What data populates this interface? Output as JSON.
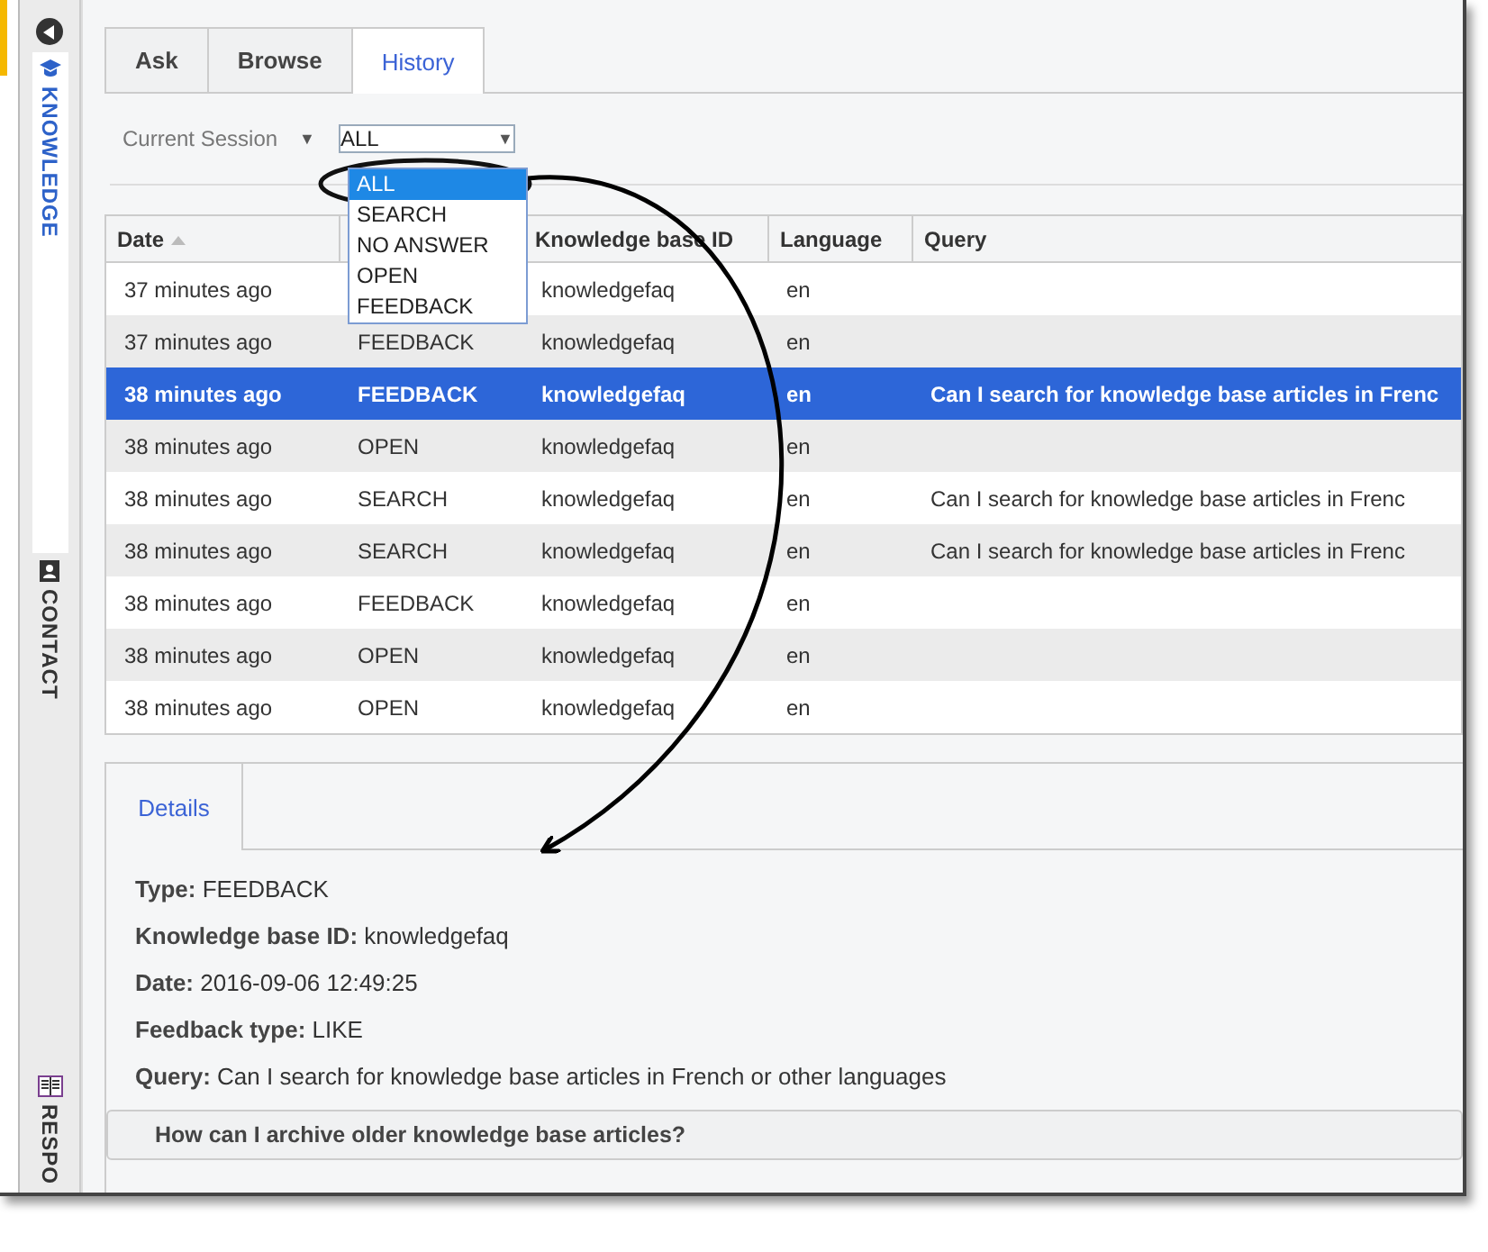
{
  "sidebar": {
    "items": [
      {
        "kind": "knowledge",
        "label": "KNOWLEDGE",
        "selected": true
      },
      {
        "kind": "contact",
        "label": "CONTACT",
        "selected": false
      },
      {
        "kind": "responses",
        "label": "RESPO",
        "selected": false
      }
    ]
  },
  "tabs": [
    {
      "label": "Ask",
      "selected": false
    },
    {
      "label": "Browse",
      "selected": false
    },
    {
      "label": "History",
      "selected": true
    }
  ],
  "filter": {
    "session": "Current Session",
    "session_caret": "▼",
    "value": "ALL",
    "caret": "▼",
    "expanded": true,
    "options": [
      {
        "label": "ALL",
        "selected": true
      },
      {
        "label": "SEARCH",
        "selected": false
      },
      {
        "label": "NO ANSWER",
        "selected": false
      },
      {
        "label": "OPEN",
        "selected": false
      },
      {
        "label": "FEEDBACK",
        "selected": false
      }
    ]
  },
  "table": {
    "columns": [
      "Date",
      "Knowledge base ID",
      "Language",
      "Query"
    ],
    "rows": [
      {
        "date": "37 minutes ago",
        "kb": "knowledgefaq",
        "language": "en",
        "selected": false
      },
      {
        "date": "37 minutes ago",
        "type": "FEEDBACK",
        "kb": "knowledgefaq",
        "language": "en",
        "selected": false
      },
      {
        "date": "38 minutes ago",
        "type": "FEEDBACK",
        "kb": "knowledgefaq",
        "language": "en",
        "query": "Can I search for knowledge base articles in Frenc",
        "selected": true
      },
      {
        "date": "38 minutes ago",
        "type": "OPEN",
        "kb": "knowledgefaq",
        "language": "en",
        "selected": false
      },
      {
        "date": "38 minutes ago",
        "type": "SEARCH",
        "kb": "knowledgefaq",
        "language": "en",
        "query": "Can I search for knowledge base articles in Frenc",
        "selected": false
      },
      {
        "date": "38 minutes ago",
        "type": "SEARCH",
        "kb": "knowledgefaq",
        "language": "en",
        "query": "Can I search for knowledge base articles in Frenc",
        "selected": false
      },
      {
        "date": "38 minutes ago",
        "type": "FEEDBACK",
        "kb": "knowledgefaq",
        "language": "en",
        "selected": false
      },
      {
        "date": "38 minutes ago",
        "type": "OPEN",
        "kb": "knowledgefaq",
        "language": "en",
        "selected": false
      },
      {
        "date": "38 minutes ago",
        "type": "OPEN",
        "kb": "knowledgefaq",
        "language": "en",
        "selected": false
      }
    ]
  },
  "details": {
    "tab": "Details",
    "fields": [
      {
        "label": "Type:",
        "value": "FEEDBACK"
      },
      {
        "label": "Knowledge base ID:",
        "value": "knowledgefaq"
      },
      {
        "label": "Date:",
        "value": "2016-09-06 12:49:25"
      },
      {
        "label": "Feedback type:",
        "value": "LIKE"
      },
      {
        "label": "Query:",
        "value": "Can I search for knowledge base articles in French or other languages"
      }
    ],
    "article": "How can I archive older knowledge base articles?"
  }
}
